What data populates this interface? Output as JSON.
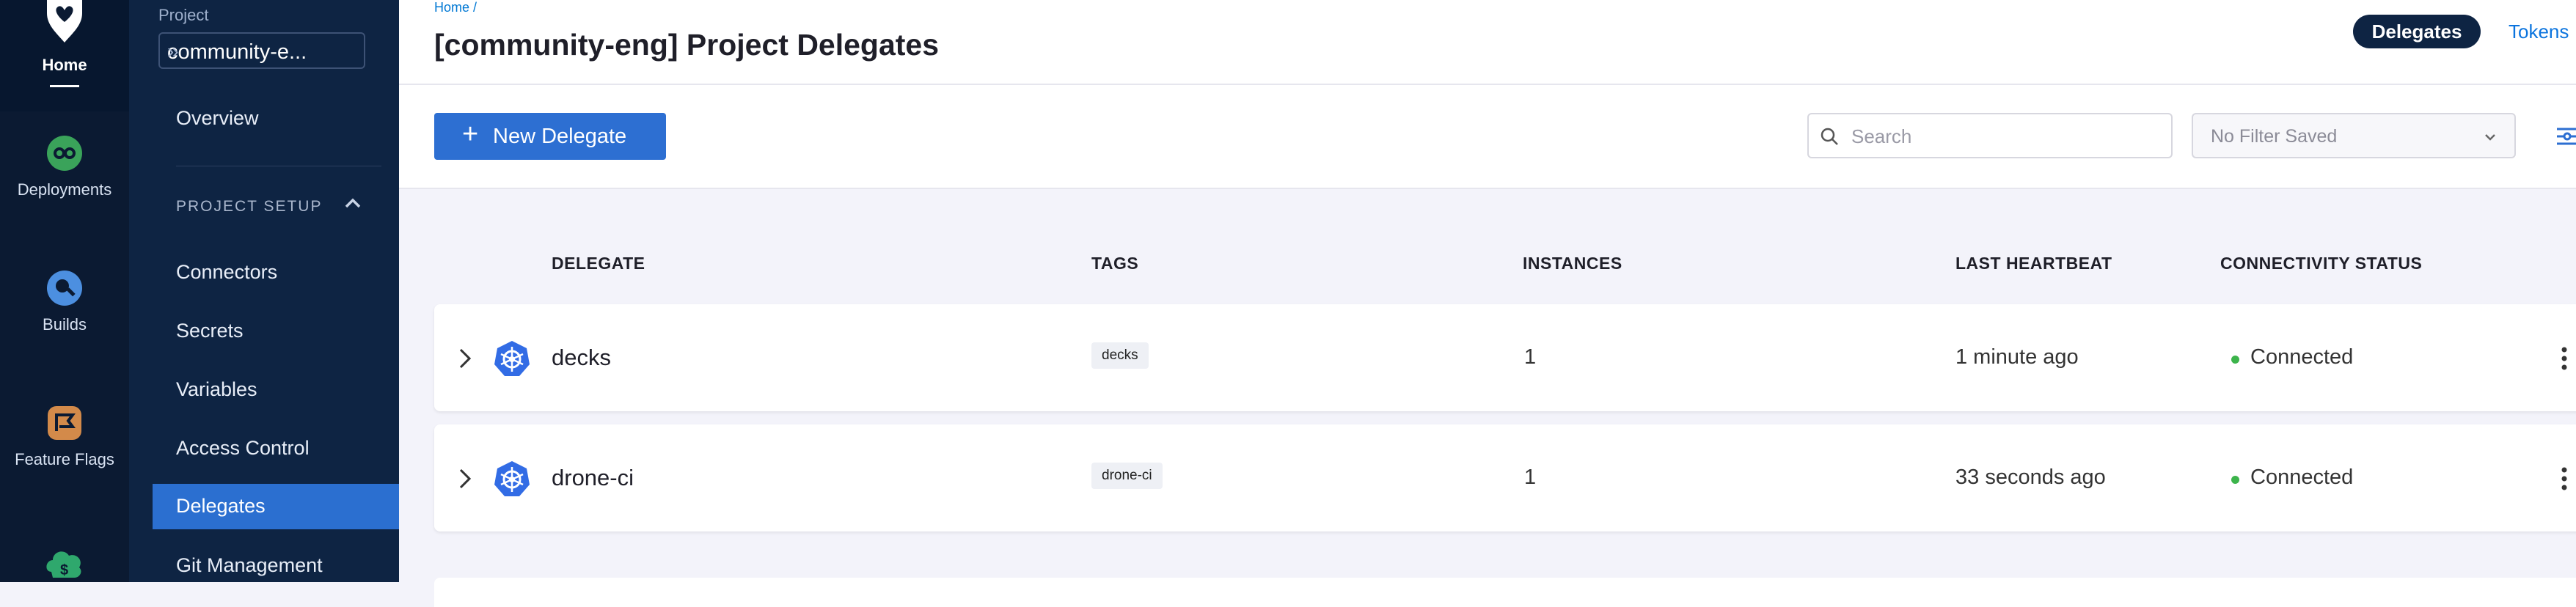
{
  "nav": {
    "home_label": "Home",
    "items": [
      {
        "label": "Deployments",
        "icon": "deployments-icon"
      },
      {
        "label": "Builds",
        "icon": "builds-icon"
      },
      {
        "label": "Feature Flags",
        "icon": "feature-flags-icon"
      }
    ]
  },
  "sidebar": {
    "project_label": "Project",
    "project_name": "community-e...",
    "overview": "Overview",
    "section_title": "PROJECT SETUP",
    "items": [
      "Connectors",
      "Secrets",
      "Variables",
      "Access Control",
      "Delegates",
      "Git Management"
    ],
    "active": "Delegates"
  },
  "header": {
    "breadcrumb": "Home /",
    "title": "[community-eng] Project Delegates",
    "tabs": [
      "Delegates",
      "Tokens"
    ]
  },
  "toolbar": {
    "new_delegate_label": "New Delegate",
    "search_placeholder": "Search",
    "filter_label": "No Filter Saved"
  },
  "table": {
    "columns": [
      "DELEGATE",
      "TAGS",
      "INSTANCES",
      "LAST HEARTBEAT",
      "CONNECTIVITY STATUS"
    ],
    "rows": [
      {
        "name": "decks",
        "tag": "decks",
        "instances": "1",
        "heartbeat": "1 minute ago",
        "status": "Connected"
      },
      {
        "name": "drone-ci",
        "tag": "drone-ci",
        "instances": "1",
        "heartbeat": "33 seconds ago",
        "status": "Connected"
      }
    ]
  },
  "colors": {
    "nav_bg": "#0b1a32",
    "sidebar_bg": "#0e2443",
    "accent": "#2d6fd2",
    "status_connected": "#3cb44b"
  }
}
